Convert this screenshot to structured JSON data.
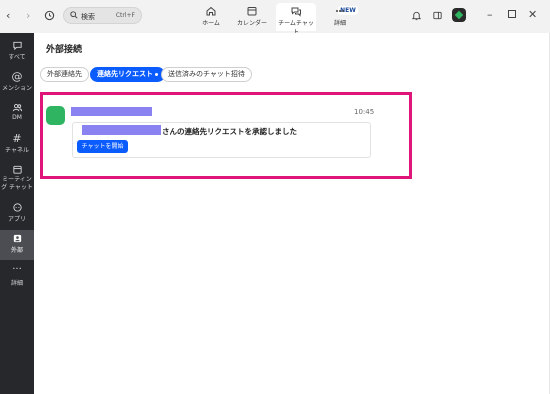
{
  "titlebar": {
    "search_label": "検索",
    "search_shortcut": "Ctrl+F",
    "tabs": [
      {
        "label": "ホーム",
        "icon": "home-icon"
      },
      {
        "label": "カレンダー",
        "icon": "calendar-icon"
      },
      {
        "label": "チームチャット",
        "icon": "chat-icon"
      },
      {
        "label": "詳細",
        "icon": "more-icon"
      }
    ],
    "new_badge": "NEW"
  },
  "sidebar": {
    "items": [
      {
        "label": "すべて",
        "icon": "chat-bubble-icon"
      },
      {
        "label": "メンション",
        "icon": "at-icon"
      },
      {
        "label": "DM",
        "icon": "people-icon"
      },
      {
        "label": "チャネル",
        "icon": "hash-icon"
      },
      {
        "label": "ミーティング チャット",
        "icon": "calendar-icon"
      },
      {
        "label": "アプリ",
        "icon": "app-icon"
      },
      {
        "label": "外部",
        "icon": "external-icon"
      },
      {
        "label": "詳細",
        "icon": "more-icon"
      }
    ]
  },
  "main": {
    "title": "外部接続",
    "filters": [
      {
        "label": "外部連絡先"
      },
      {
        "label": "連絡先リクエスト"
      },
      {
        "label": "送信済みのチャット招待"
      }
    ],
    "message": {
      "time": "10:45",
      "text": "さんの連絡先リクエストを承認しました",
      "button": "チャットを開始"
    }
  },
  "colors": {
    "accent": "#0b5cff",
    "highlight": "#e0157a",
    "avatar": "#2fb562",
    "redaction": "#8b82f2",
    "sidebar_bg": "#26282c"
  }
}
